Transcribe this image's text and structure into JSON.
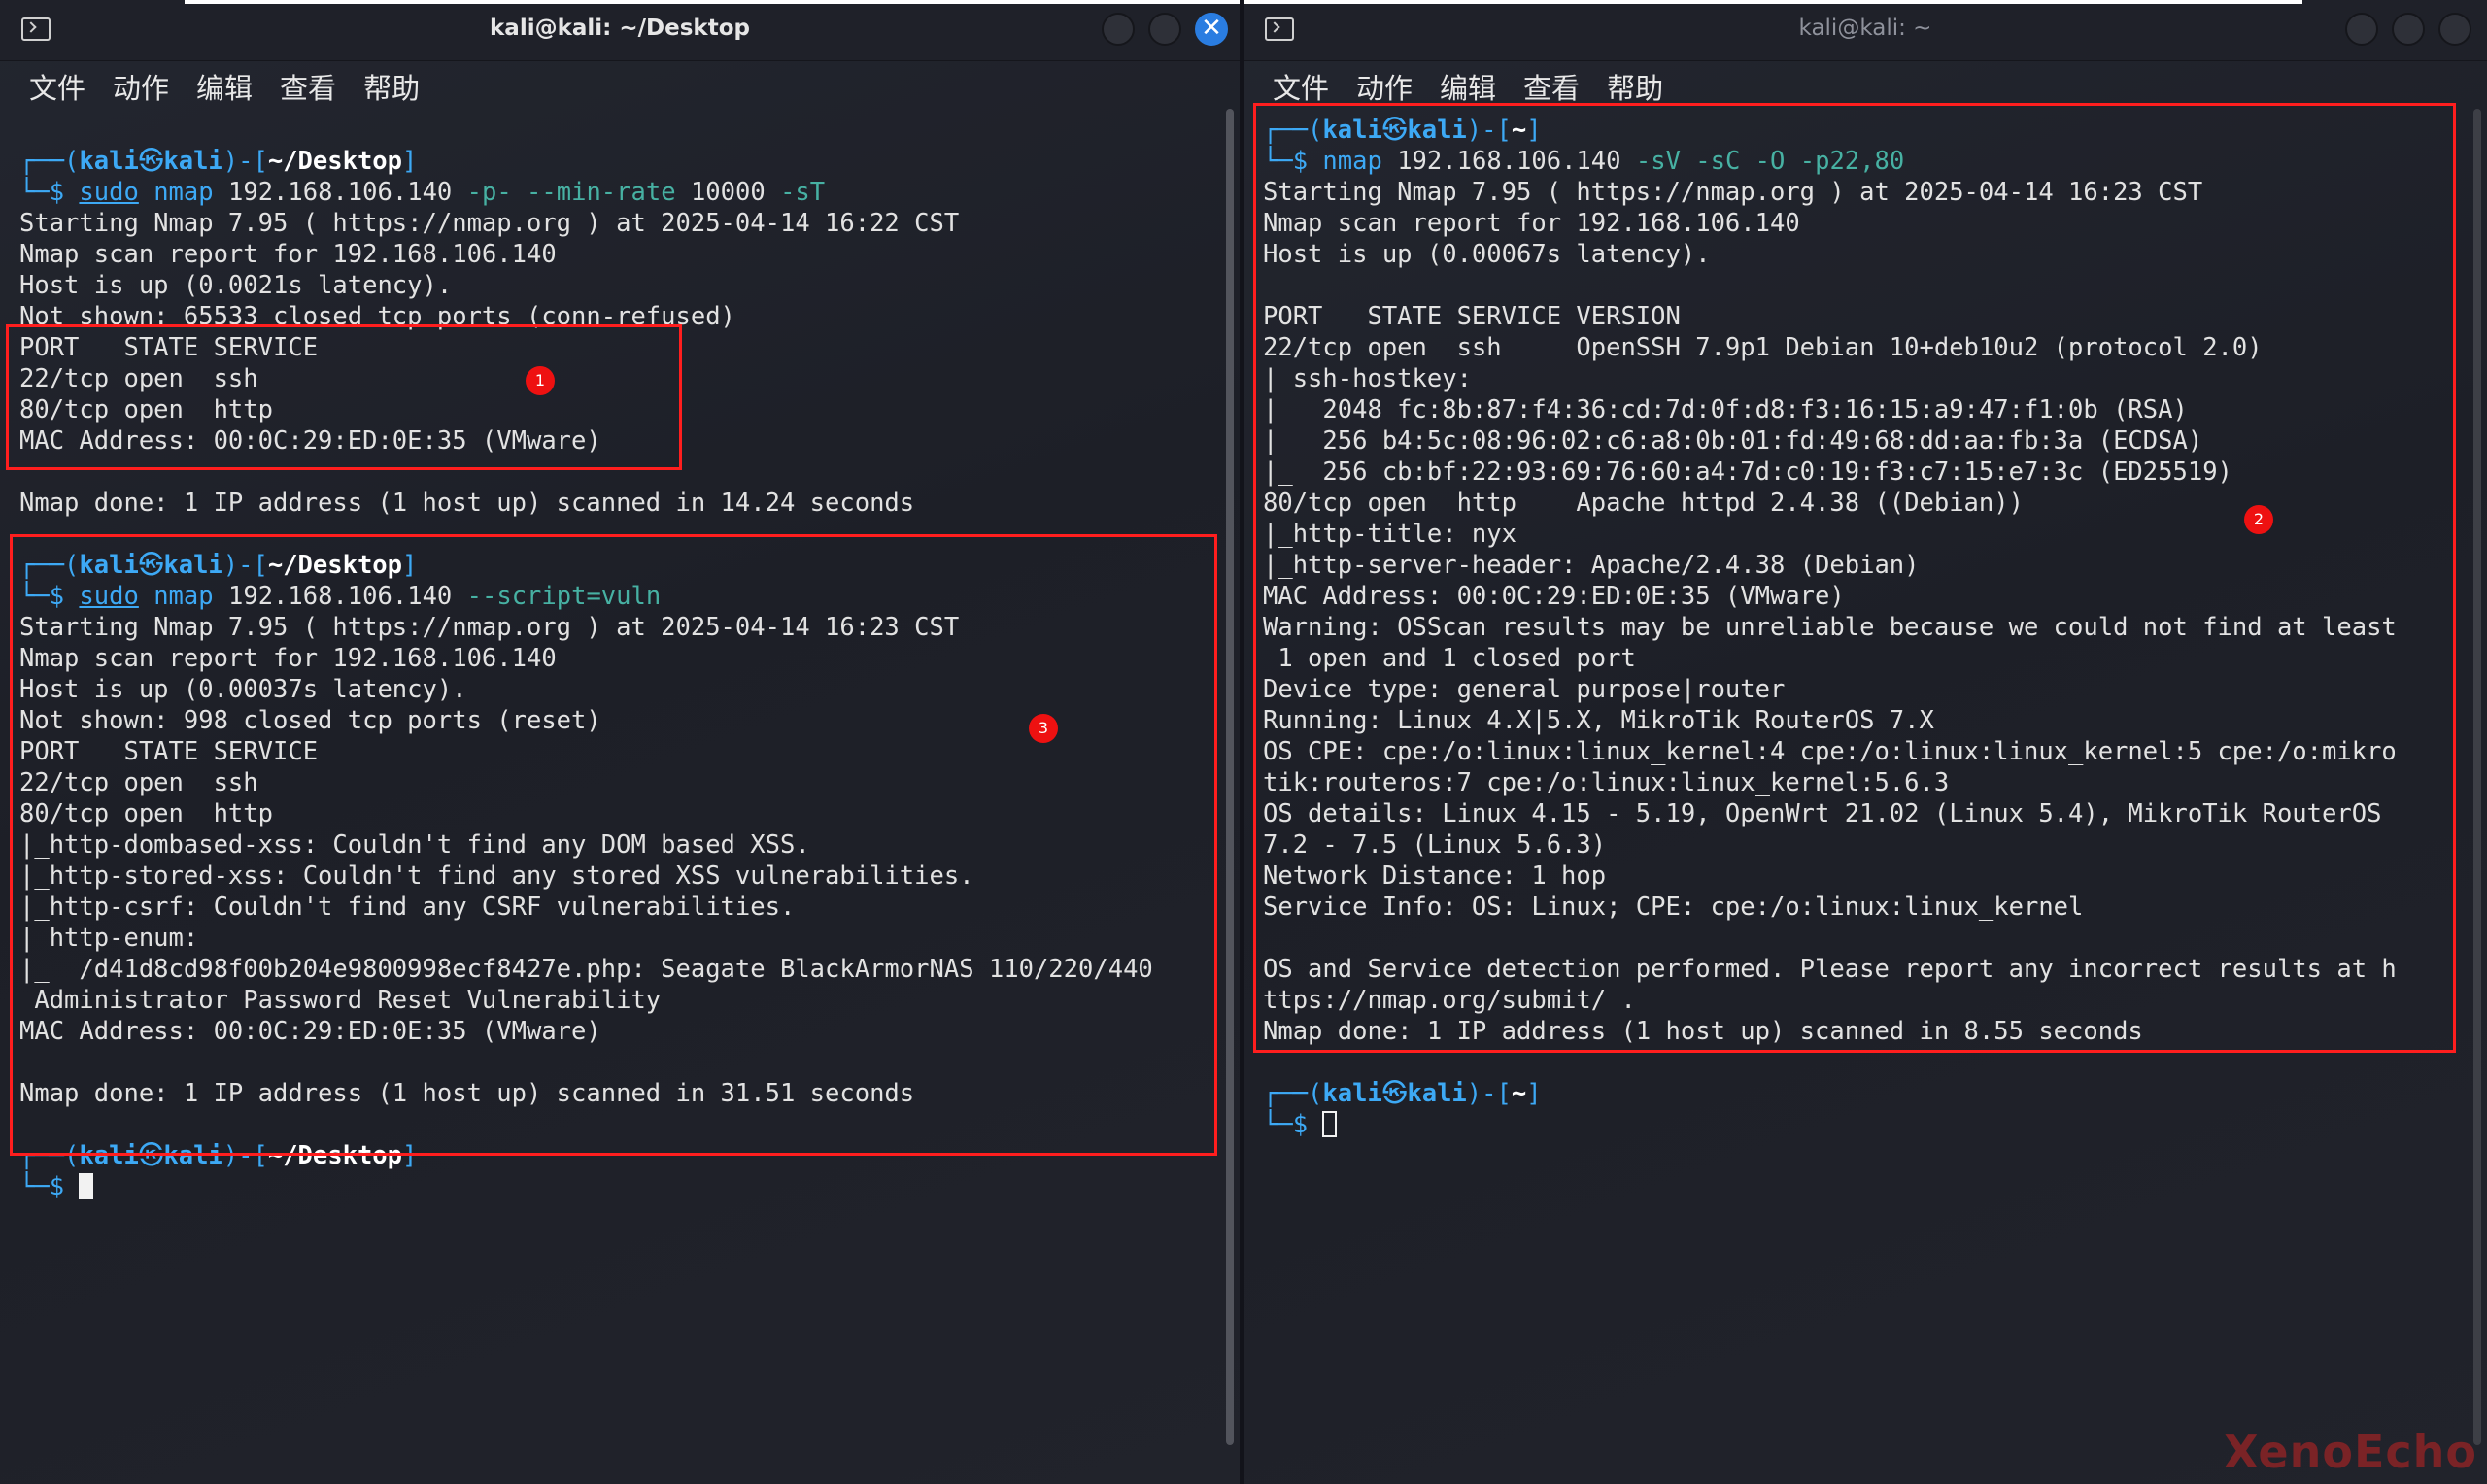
{
  "left_window": {
    "title": "kali@kali: ~/Desktop",
    "close_glyph": "✕",
    "menu": [
      "文件",
      "动作",
      "编辑",
      "查看",
      "帮助"
    ],
    "prompt1": {
      "user": "kali",
      "at": "㉿",
      "host": "kali",
      "path": "~/Desktop",
      "sudo": "sudo",
      "cmd": "nmap",
      "target": "192.168.106.140",
      "opts": "-p- --min-rate",
      "num": "10000",
      "flag": "-sT"
    },
    "scan1": [
      "Starting Nmap 7.95 ( https://nmap.org ) at 2025-04-14 16:22 CST",
      "Nmap scan report for 192.168.106.140",
      "Host is up (0.0021s latency).",
      "Not shown: 65533 closed tcp ports (conn-refused)",
      "PORT   STATE SERVICE",
      "22/tcp open  ssh",
      "80/tcp open  http",
      "MAC Address: 00:0C:29:ED:0E:35 (VMware)",
      "",
      "Nmap done: 1 IP address (1 host up) scanned in 14.24 seconds"
    ],
    "prompt2": {
      "user": "kali",
      "at": "㉿",
      "host": "kali",
      "path": "~/Desktop",
      "sudo": "sudo",
      "cmd": "nmap",
      "target": "192.168.106.140",
      "opts": "--script=vuln"
    },
    "scan2": [
      "Starting Nmap 7.95 ( https://nmap.org ) at 2025-04-14 16:23 CST",
      "Nmap scan report for 192.168.106.140",
      "Host is up (0.00037s latency).",
      "Not shown: 998 closed tcp ports (reset)",
      "PORT   STATE SERVICE",
      "22/tcp open  ssh",
      "80/tcp open  http",
      "|_http-dombased-xss: Couldn't find any DOM based XSS.",
      "|_http-stored-xss: Couldn't find any stored XSS vulnerabilities.",
      "|_http-csrf: Couldn't find any CSRF vulnerabilities.",
      "| http-enum: ",
      "|_  /d41d8cd98f00b204e9800998ecf8427e.php: Seagate BlackArmorNAS 110/220/440",
      " Administrator Password Reset Vulnerability",
      "MAC Address: 00:0C:29:ED:0E:35 (VMware)",
      "",
      "Nmap done: 1 IP address (1 host up) scanned in 31.51 seconds"
    ],
    "prompt3": {
      "user": "kali",
      "at": "㉿",
      "host": "kali",
      "path": "~/Desktop"
    },
    "badges": [
      "1",
      "3"
    ]
  },
  "right_window": {
    "title": "kali@kali: ~",
    "menu": [
      "文件",
      "动作",
      "编辑",
      "查看",
      "帮助"
    ],
    "prompt1": {
      "user": "kali",
      "at": "㉿",
      "host": "kali",
      "path": "~",
      "cmd": "nmap",
      "target": "192.168.106.140",
      "opts": "-sV -sC -O -p22,80"
    },
    "scan": [
      "Starting Nmap 7.95 ( https://nmap.org ) at 2025-04-14 16:23 CST",
      "Nmap scan report for 192.168.106.140",
      "Host is up (0.00067s latency).",
      "",
      "PORT   STATE SERVICE VERSION",
      "22/tcp open  ssh     OpenSSH 7.9p1 Debian 10+deb10u2 (protocol 2.0)",
      "| ssh-hostkey: ",
      "|   2048 fc:8b:87:f4:36:cd:7d:0f:d8:f3:16:15:a9:47:f1:0b (RSA)",
      "|   256 b4:5c:08:96:02:c6:a8:0b:01:fd:49:68:dd:aa:fb:3a (ECDSA)",
      "|_  256 cb:bf:22:93:69:76:60:a4:7d:c0:19:f3:c7:15:e7:3c (ED25519)",
      "80/tcp open  http    Apache httpd 2.4.38 ((Debian))",
      "|_http-title: nyx",
      "|_http-server-header: Apache/2.4.38 (Debian)",
      "MAC Address: 00:0C:29:ED:0E:35 (VMware)",
      "Warning: OSScan results may be unreliable because we could not find at least",
      " 1 open and 1 closed port",
      "Device type: general purpose|router",
      "Running: Linux 4.X|5.X, MikroTik RouterOS 7.X",
      "OS CPE: cpe:/o:linux:linux_kernel:4 cpe:/o:linux:linux_kernel:5 cpe:/o:mikro",
      "tik:routeros:7 cpe:/o:linux:linux_kernel:5.6.3",
      "OS details: Linux 4.15 - 5.19, OpenWrt 21.02 (Linux 5.4), MikroTik RouterOS",
      "7.2 - 7.5 (Linux 5.6.3)",
      "Network Distance: 1 hop",
      "Service Info: OS: Linux; CPE: cpe:/o:linux:linux_kernel",
      "",
      "OS and Service detection performed. Please report any incorrect results at h",
      "ttps://nmap.org/submit/ .",
      "Nmap done: 1 IP address (1 host up) scanned in 8.55 seconds"
    ],
    "prompt2": {
      "user": "kali",
      "at": "㉿",
      "host": "kali",
      "path": "~"
    },
    "badges": [
      "2"
    ]
  },
  "watermark": "XenoEcho",
  "colors": {
    "accent_blue": "#3da9f5",
    "option_teal": "#47b1a3",
    "highlight_red": "#ff1e1e",
    "close_blue": "#2a7de1"
  }
}
